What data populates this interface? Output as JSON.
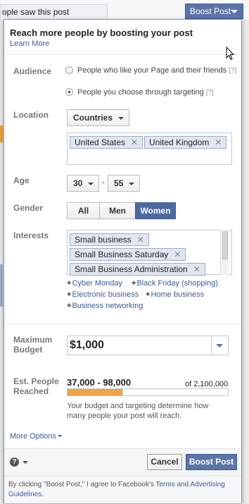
{
  "background": {
    "people_saw": "ople saw this post",
    "boost_button_label": "Boost Post"
  },
  "header": {
    "title": "Reach more people by boosting your post",
    "learn_more": "Learn More"
  },
  "audience": {
    "label": "Audience",
    "options": [
      {
        "label": "People who like your Page and their friends",
        "hint": "[?]",
        "selected": false
      },
      {
        "label": "People you choose through targeting",
        "hint": "[?]",
        "selected": true
      }
    ]
  },
  "location": {
    "label": "Location",
    "dropdown": "Countries",
    "tokens": [
      "United States",
      "United Kingdom"
    ]
  },
  "age": {
    "label": "Age",
    "min": "30",
    "separator": "-",
    "max": "55"
  },
  "gender": {
    "label": "Gender",
    "options": [
      "All",
      "Men",
      "Women"
    ],
    "selected": "Women"
  },
  "interests": {
    "label": "Interests",
    "tokens": [
      "Small business",
      "Small Business Saturday",
      "Small Business Administration"
    ],
    "suggestions": [
      "Cyber Monday",
      "Black Friday (shopping)",
      "Electronic business",
      "Home business",
      "Business networking"
    ]
  },
  "budget": {
    "label_line1": "Maximum",
    "label_line2": "Budget",
    "value": "$1,000"
  },
  "reach": {
    "label_line1": "Est. People",
    "label_line2": "Reached",
    "range": "37,000 - 98,000",
    "total": "of 2,100,000",
    "fraction": 0.34,
    "note": "Your budget and targeting determine how many people your post will reach."
  },
  "more_options": "More Options",
  "footer": {
    "cancel": "Cancel",
    "boost": "Boost Post"
  },
  "terms": {
    "prefix": "By clicking \"Boost Post,\" I agree to Facebook's ",
    "link": "Terms and Advertising Guidelines",
    "suffix": "."
  },
  "colors": {
    "accent": "#3b5998",
    "button_blue": "#5b74a8",
    "reach_fill": "#f0a445"
  }
}
